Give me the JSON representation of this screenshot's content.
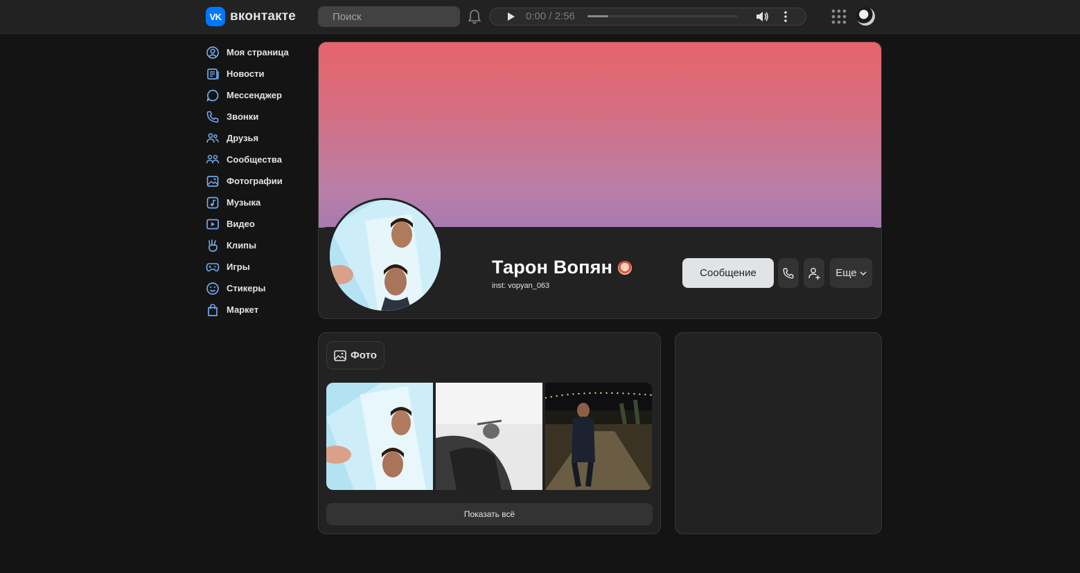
{
  "header": {
    "logo_text": "вконтакте",
    "logo_mark": "VK",
    "search_placeholder": "Поиск",
    "player": {
      "time": "0:00 / 2:56",
      "progress_fraction": 0.14
    },
    "icons": [
      "bell-icon",
      "play-icon",
      "volume-icon",
      "more-vertical-icon",
      "apps-grid-icon"
    ]
  },
  "sidebar": {
    "items": [
      {
        "label": "Моя страница",
        "icon": "user-circle-icon"
      },
      {
        "label": "Новости",
        "icon": "newspaper-icon"
      },
      {
        "label": "Мессенджер",
        "icon": "chat-bubble-icon"
      },
      {
        "label": "Звонки",
        "icon": "phone-icon"
      },
      {
        "label": "Друзья",
        "icon": "friends-icon"
      },
      {
        "label": "Сообщества",
        "icon": "communities-icon"
      },
      {
        "label": "Фотографии",
        "icon": "photo-icon"
      },
      {
        "label": "Музыка",
        "icon": "music-icon"
      },
      {
        "label": "Видео",
        "icon": "video-icon"
      },
      {
        "label": "Клипы",
        "icon": "clips-icon"
      },
      {
        "label": "Игры",
        "icon": "gamepad-icon"
      },
      {
        "label": "Стикеры",
        "icon": "smile-icon"
      },
      {
        "label": "Маркет",
        "icon": "shopping-bag-icon"
      }
    ]
  },
  "profile": {
    "name": "Тарон Вопян",
    "status": "inst: vopyan_063",
    "message_button": "Сообщение",
    "more_button": "Еще"
  },
  "photos": {
    "tab_label": "Фото",
    "show_all": "Показать всё"
  },
  "colors": {
    "background": "#141414",
    "card": "#222222",
    "accent": "#0077ff",
    "icon_blue": "#71aaeb",
    "cover_top": "#e6646a",
    "cover_bottom": "#a77ab0"
  }
}
